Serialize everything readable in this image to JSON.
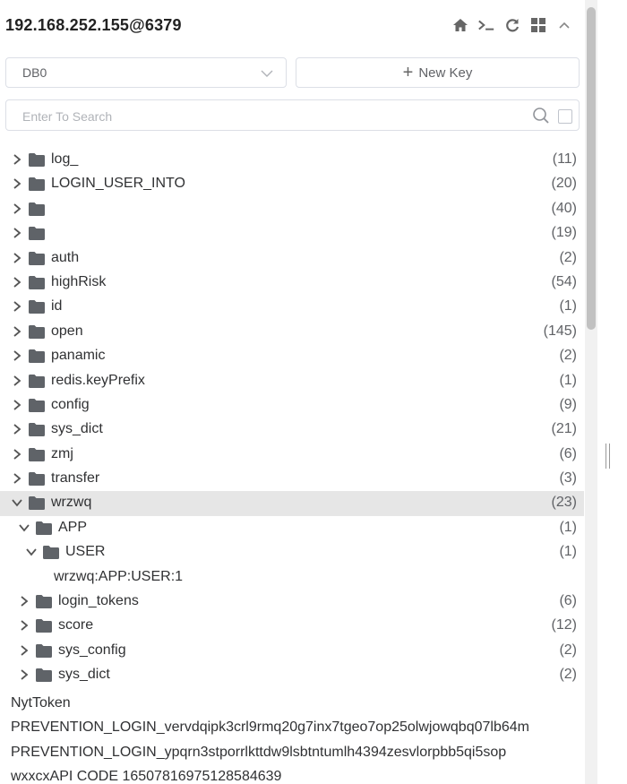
{
  "header": {
    "connection_title": "192.168.252.155@6379",
    "icons": [
      "home-icon",
      "terminal-icon",
      "refresh-icon",
      "grid-icon",
      "chevron-up-icon"
    ]
  },
  "db_select": {
    "value": "DB0"
  },
  "new_key": {
    "label": "New Key"
  },
  "search": {
    "placeholder": "Enter To Search",
    "value": ""
  },
  "tree": [
    {
      "label": "log_",
      "count": "(11)",
      "depth": 0,
      "expanded": false
    },
    {
      "label": "LOGIN_USER_INTO",
      "count": "(20)",
      "depth": 0,
      "expanded": false
    },
    {
      "label": "",
      "count": "(40)",
      "depth": 0,
      "expanded": false
    },
    {
      "label": "",
      "count": "(19)",
      "depth": 0,
      "expanded": false
    },
    {
      "label": "auth",
      "count": "(2)",
      "depth": 0,
      "expanded": false
    },
    {
      "label": "highRisk",
      "count": "(54)",
      "depth": 0,
      "expanded": false
    },
    {
      "label": "id",
      "count": "(1)",
      "depth": 0,
      "expanded": false
    },
    {
      "label": "open",
      "count": "(145)",
      "depth": 0,
      "expanded": false
    },
    {
      "label": "panamic",
      "count": "(2)",
      "depth": 0,
      "expanded": false
    },
    {
      "label": "redis.keyPrefix",
      "count": "(1)",
      "depth": 0,
      "expanded": false
    },
    {
      "label": "config",
      "count": "(9)",
      "depth": 0,
      "expanded": false
    },
    {
      "label": "sys_dict",
      "count": "(21)",
      "depth": 0,
      "expanded": false
    },
    {
      "label": "zmj",
      "count": "(6)",
      "depth": 0,
      "expanded": false
    },
    {
      "label": "transfer",
      "count": "(3)",
      "depth": 0,
      "expanded": false
    },
    {
      "label": "wrzwq",
      "count": "(23)",
      "depth": 0,
      "expanded": true,
      "active": true
    },
    {
      "label": "APP",
      "count": "(1)",
      "depth": 1,
      "expanded": true
    },
    {
      "label": "USER",
      "count": "(1)",
      "depth": 2,
      "expanded": true
    },
    {
      "label": "wrzwq:APP:USER:1",
      "count": "",
      "depth": 3,
      "leaf": true
    },
    {
      "label": "login_tokens",
      "count": "(6)",
      "depth": 1,
      "expanded": false
    },
    {
      "label": "score",
      "count": "(12)",
      "depth": 1,
      "expanded": false
    },
    {
      "label": "sys_config",
      "count": "(2)",
      "depth": 1,
      "expanded": false
    },
    {
      "label": "sys_dict",
      "count": "(2)",
      "depth": 1,
      "expanded": false
    }
  ],
  "keys": [
    "NytToken",
    "PREVENTION_LOGIN_vervdqipk3crl9rmq20g7inx7tgeo7op25olwjowqbq07lb64m",
    "PREVENTION_LOGIN_ypqrn3stporrlkttdw9lsbtntumlh4394zesvlorpbb5qi5sop",
    "wxxcxAPI CODE 16507816975128584639"
  ]
}
